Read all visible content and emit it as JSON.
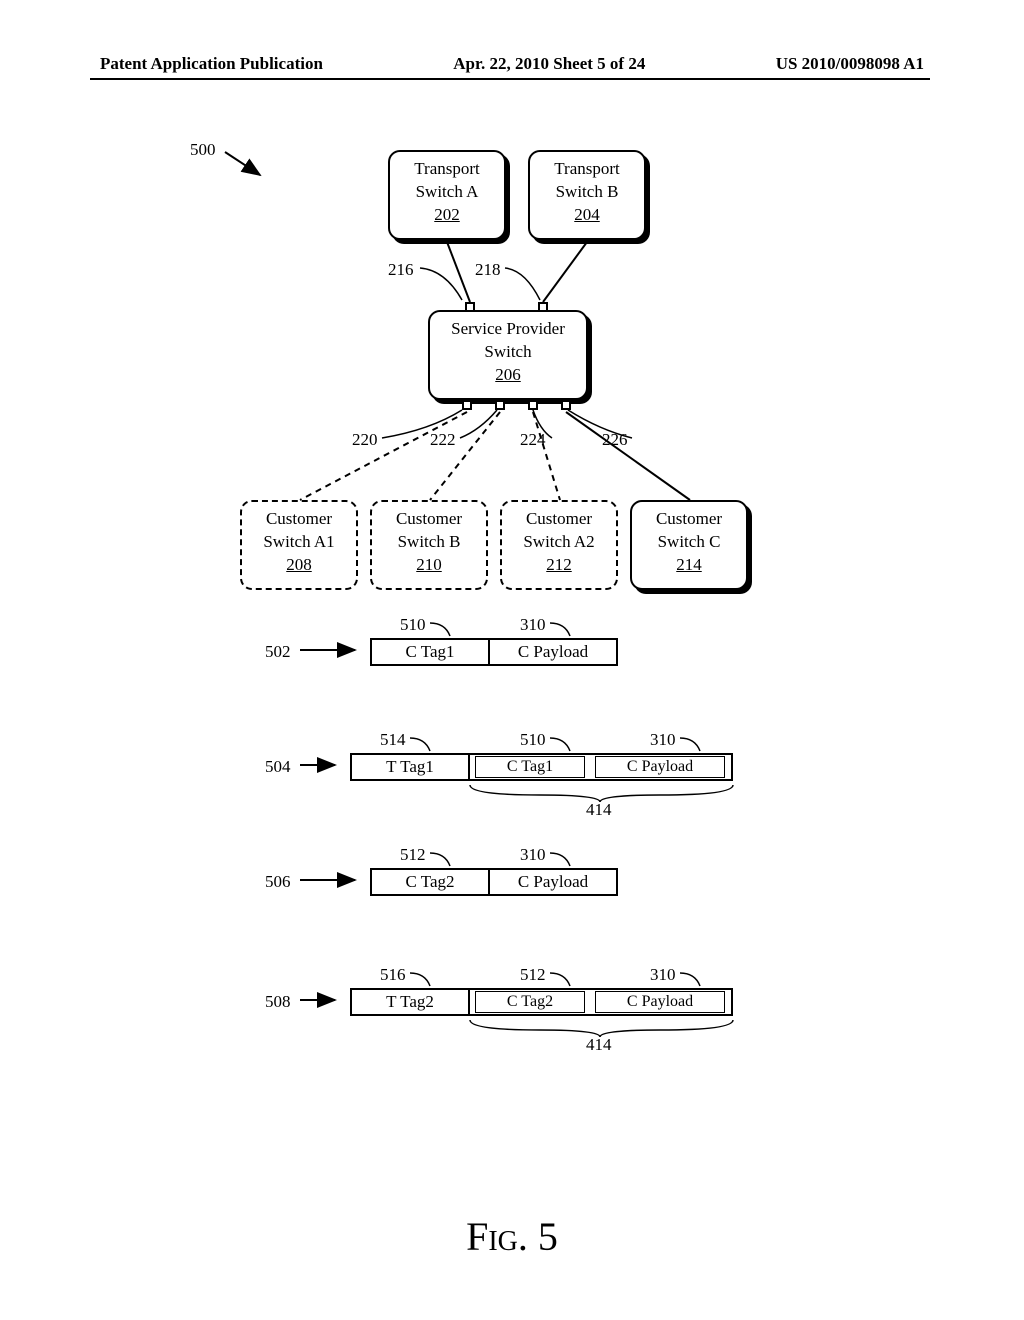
{
  "header": {
    "left": "Patent Application Publication",
    "center": "Apr. 22, 2010  Sheet 5 of 24",
    "right": "US 2010/0098098 A1"
  },
  "figure": {
    "caption": "Fig. 5",
    "ref500": "500"
  },
  "switches": {
    "transportA": {
      "l1": "Transport",
      "l2": "Switch A",
      "ref": "202"
    },
    "transportB": {
      "l1": "Transport",
      "l2": "Switch B",
      "ref": "204"
    },
    "sp": {
      "l1": "Service Provider",
      "l2": "Switch",
      "ref": "206"
    },
    "ca1": {
      "l1": "Customer",
      "l2": "Switch A1",
      "ref": "208"
    },
    "cb": {
      "l1": "Customer",
      "l2": "Switch B",
      "ref": "210"
    },
    "ca2": {
      "l1": "Customer",
      "l2": "Switch A2",
      "ref": "212"
    },
    "cc": {
      "l1": "Customer",
      "l2": "Switch C",
      "ref": "214"
    }
  },
  "ports": {
    "p216": "216",
    "p218": "218",
    "p220": "220",
    "p222": "222",
    "p224": "224",
    "p226": "226"
  },
  "packets": {
    "row502": {
      "ref": "502",
      "tag510_lbl": "510",
      "tag510": "C Tag1",
      "p310_lbl": "310",
      "p310": "C Payload"
    },
    "row504": {
      "ref": "504",
      "ttag514_lbl": "514",
      "ttag514": "T Tag1",
      "tag510_lbl": "510",
      "tag510": "C Tag1",
      "p310_lbl": "310",
      "p310": "C Payload",
      "enc414": "414"
    },
    "row506": {
      "ref": "506",
      "tag512_lbl": "512",
      "tag512": "C Tag2",
      "p310_lbl": "310",
      "p310": "C Payload"
    },
    "row508": {
      "ref": "508",
      "ttag516_lbl": "516",
      "ttag516": "T Tag2",
      "tag512_lbl": "512",
      "tag512": "C Tag2",
      "p310_lbl": "310",
      "p310": "C Payload",
      "enc414": "414"
    }
  }
}
